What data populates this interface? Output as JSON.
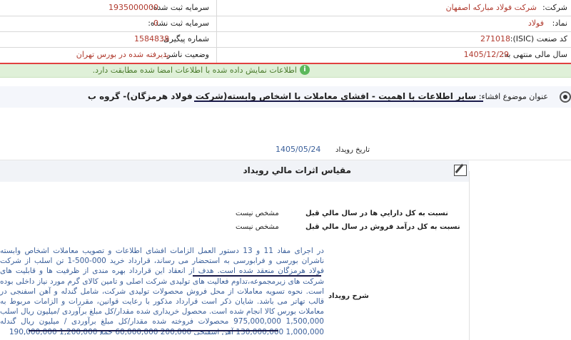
{
  "company_info": {
    "company_label": "شرکت:",
    "company_value": "شرکت فولاد مبارکه اصفهان",
    "symbol_label": "نماد:",
    "symbol_value": "فولاد",
    "isic_label": "کد صنعت (ISIC):",
    "isic_value": "271018",
    "fiscal_label": "سال مالی منتهی به:",
    "fiscal_value": "1405/12/29",
    "registered_capital_label": "سرمایه ثبت شده:",
    "registered_capital_value": "1935000000",
    "unregistered_capital_label": "سرمایه ثبت نشده:",
    "unregistered_capital_value": "0",
    "tracking_label": "شماره پیگیری:",
    "tracking_value": "1584838",
    "status_label": "وضعیت ناشر:",
    "status_value": "پذیرفته شده در بورس تهران"
  },
  "notice": {
    "text": "اطلاعات نمایش داده شده با اطلاعات امضا شده مطابقت دارد.",
    "icon": "info-icon",
    "color": "#dff0d8"
  },
  "subject": {
    "label": "عنوان موضوع افشاء:",
    "value": "سایر اطلاعات با اهمیت - افشاي معاملات با اشخاص وابسته(شرکت فولاد هرمزگان)- گروه ب"
  },
  "event": {
    "date_label": "تاریخ رویداد",
    "date_value": "1405/05/24"
  },
  "section": {
    "title": "مقیاس اثرات مالي رويداد",
    "icon": "edit-icon"
  },
  "metrics": [
    {
      "label": "نسبت به كل دارايي ها در سال مالي قبل",
      "value": "مشخص نیست"
    },
    {
      "label": "نسبت به كل درآمد فروش در سال مالي قبل",
      "value": "مشخص نیست"
    }
  ],
  "description": {
    "label": "شرح رويداد",
    "text": "در اجرای مفاد 11 و 13 دستور العمل الزامات افشای اطلاعات و تصویب معاملات اشخاص وابسته ناشران بورسی و فرابورسی به استحضار می رساند، قرارداد خرید 000-500-1 تن اسلب از شرکت فولاد هرمزگان منعقد شده است. هدف از انعقاد این قرارداد بهره مندی از ظرفیت ها و قابلیت های شرکت های زیرمجموعه،تداوم فعالیت های تولیدی شرکت اصلی و تامین کالای گرم مورد نیاز داخلی بوده است. نحوه تسویه معاملات از محل فروش محصولات تولیدی شرکت، شامل گندله و آهن اسفنجی در قالب تهاتر می باشد. شایان ذکر است قرارداد مذکور با رعایت قوانین، مقررات و الزامات مربوط به معاملات بورس کالا انجام شده است. محصول خریداری شده مقدار/کل مبلغ برآوردی /میلیون ریال اسلب 1,500,000 975,000,000 محصولات فروخته شده مقدار/کل مبلغ برآوردی / میلیون ریال گندله 1,000,000 130,000,000 آهن اسفنجی 200,000 60,000,000 جمع 1,200,000 190,000,000"
  }
}
